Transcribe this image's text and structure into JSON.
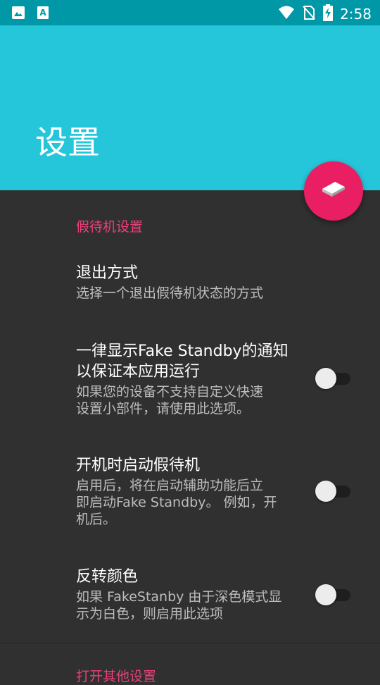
{
  "status_bar": {
    "time": "2:58",
    "icons": [
      "image-icon",
      "text-icon",
      "wifi-icon",
      "no-sim-icon",
      "battery-charging-icon"
    ]
  },
  "header": {
    "title": "设置"
  },
  "fab": {
    "icon": "standby-icon",
    "color": "#e91e63"
  },
  "categories": [
    {
      "title": "假待机设置"
    },
    {
      "title": "打开其他设置"
    }
  ],
  "preferences": [
    {
      "title": "退出方式",
      "summary": "选择一个退出假待机状态的方式"
    },
    {
      "title_line1": "一律显示Fake Standby的通知",
      "title_line2": "以保证本应用运行",
      "summary_line1": "如果您的设备不支持自定义快速",
      "summary_line2": "设置小部件，请使用此选项。",
      "switch_on": false
    },
    {
      "title": "开机时启动假待机",
      "summary_line1": "启用后，将在启动辅助功能后立",
      "summary_line2": "即启动Fake Standby。 例如，开",
      "summary_line3": "机后。",
      "switch_on": false
    },
    {
      "title": "反转颜色",
      "summary_line1": "如果 FakeStanby 由于深色模式显",
      "summary_line2": "示为白色，则启用此选项",
      "switch_on": false
    }
  ],
  "colors": {
    "header": "#26c6da",
    "status_bar": "#0097a7",
    "accent": "#ec407a",
    "background": "#303030"
  }
}
